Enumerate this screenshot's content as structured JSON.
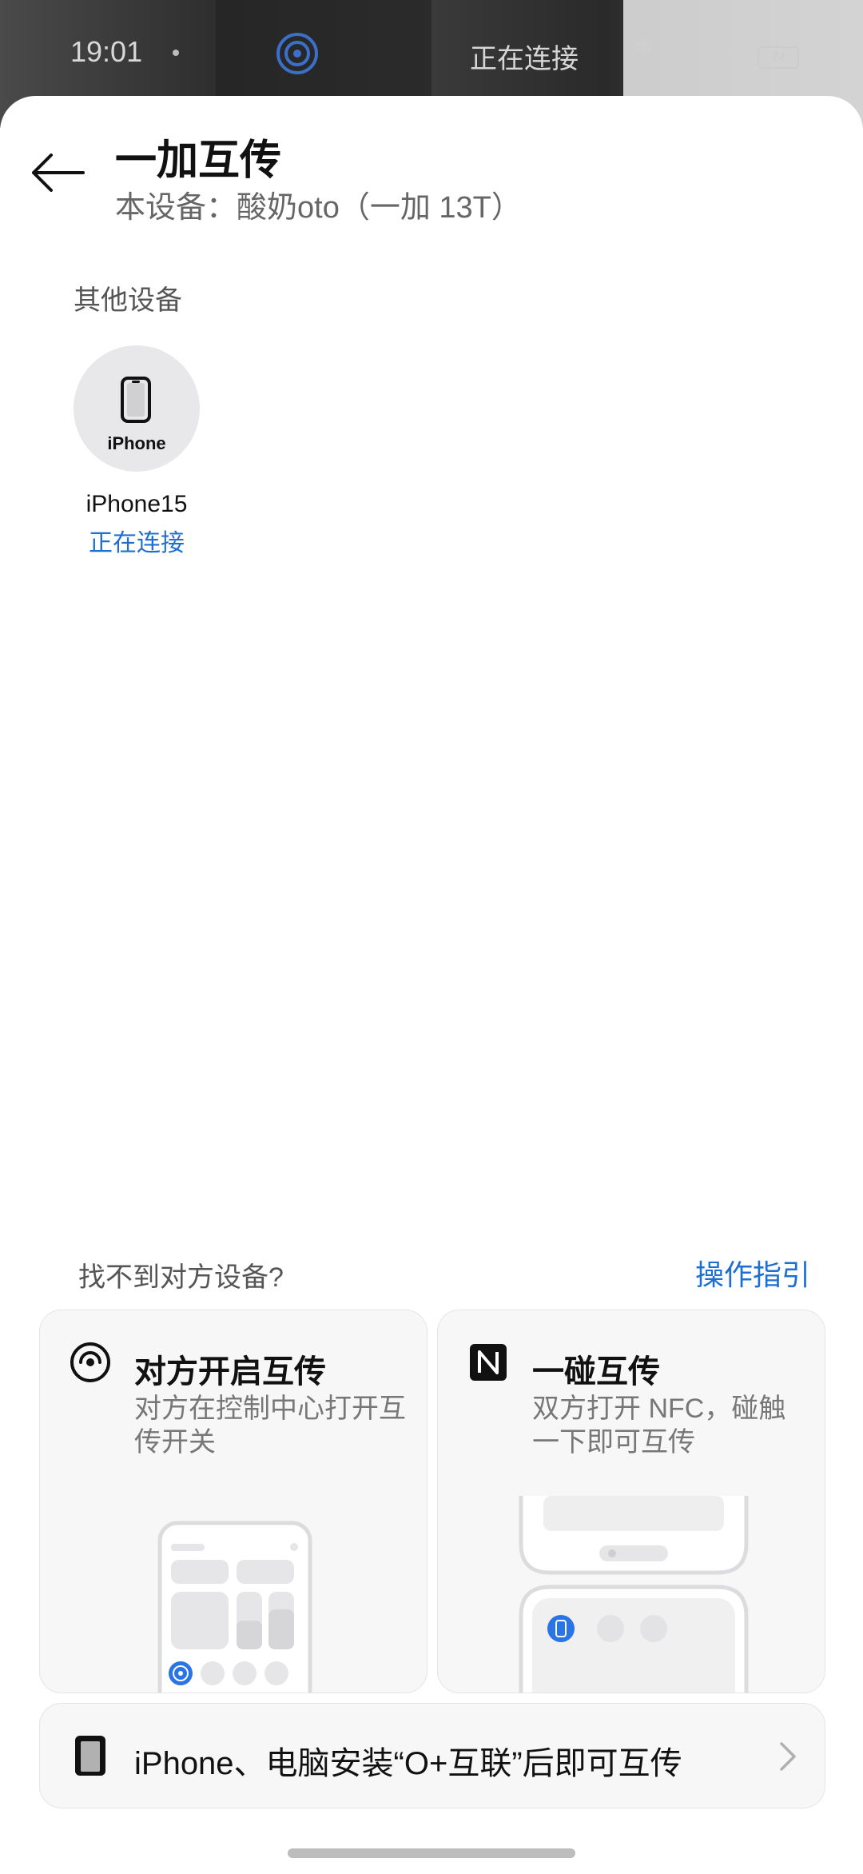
{
  "status_bar": {
    "time": "19:01",
    "connecting_label": "正在连接",
    "icons": "✱ ◔ 5G ıll",
    "battery": "24"
  },
  "header": {
    "title": "一加互传",
    "subtitle": "本设备：酸奶oto（一加 13T）"
  },
  "devices_section": {
    "label": "其他设备",
    "devices": [
      {
        "badge": "iPhone",
        "name": "iPhone15",
        "status": "正在连接"
      }
    ]
  },
  "help": {
    "prompt": "找不到对方设备?",
    "guide_link": "操作指引"
  },
  "cards": [
    {
      "title": "对方开启互传",
      "desc": "对方在控制中心打开互传开关"
    },
    {
      "title": "一碰互传",
      "desc": "双方打开 NFC，碰触一下即可互传"
    }
  ],
  "bottom_bar": {
    "text": "iPhone、电脑安装“O+互联”后即可互传"
  },
  "colors": {
    "accent": "#1f6fd1",
    "card_bg": "#f7f7f8"
  }
}
